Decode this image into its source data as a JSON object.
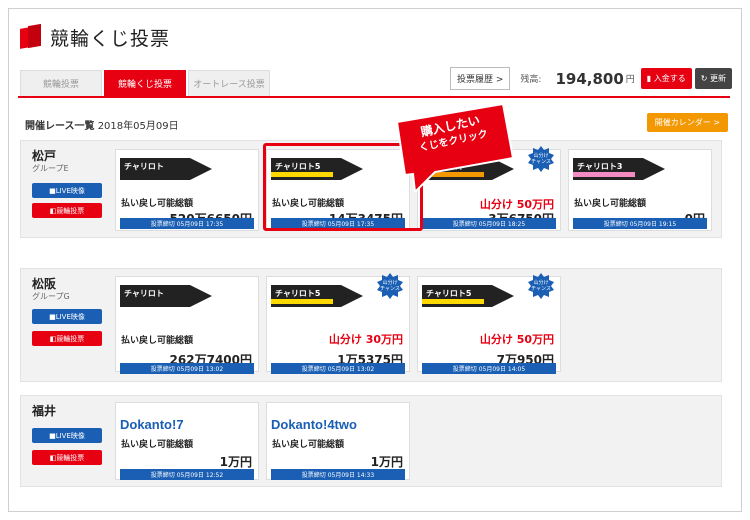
{
  "header": {
    "title": "競輪くじ投票"
  },
  "tabs": [
    {
      "label": "競輪投票",
      "active": false
    },
    {
      "label": "競輪くじ投票",
      "active": true
    },
    {
      "label": "オートレース投票",
      "active": false
    }
  ],
  "account": {
    "history_label": "投票履歴 >",
    "balance_label": "残高:",
    "balance_value": "194,800",
    "balance_unit": "円",
    "deposit_label": "入金する",
    "refresh_label": "更新"
  },
  "list": {
    "title": "開催レース一覧",
    "date": "2018年05月09日",
    "calendar_label": "開催カレンダー >"
  },
  "buttons": {
    "live": "LIVE映像",
    "bet": "競輪投票"
  },
  "payout_label": "払い戻し可能総額",
  "chance_badge": [
    "山分け",
    "チャンス"
  ],
  "callout": {
    "line1": "購入したい",
    "line2": "くじをクリック"
  },
  "races": [
    {
      "venue": "松戸",
      "group": "グループE",
      "cards": [
        {
          "logo": "チャリロト",
          "yamawake": "",
          "amount": "520万6650円",
          "deadline": "投票締切 05月09日 17:35"
        },
        {
          "logo": "チャリロト5",
          "yamawake": "",
          "amount": "14万3475円",
          "deadline": "投票締切 05月09日 17:35"
        },
        {
          "logo": "チャリロト",
          "yamawake": "山分け 50万円",
          "amount": "3万6750円",
          "deadline": "投票締切 05月09日 18:25"
        },
        {
          "logo": "チャリロト3",
          "yamawake": "",
          "amount": "0円",
          "deadline": "投票締切 05月09日 19:15"
        }
      ]
    },
    {
      "venue": "松阪",
      "group": "グループG",
      "cards": [
        {
          "logo": "チャリロト",
          "yamawake": "",
          "amount": "262万7400円",
          "deadline": "投票締切 05月09日 13:02"
        },
        {
          "logo": "チャリロト5",
          "yamawake": "山分け 30万円",
          "amount": "1万5375円",
          "deadline": "投票締切 05月09日 13:02"
        },
        {
          "logo": "チャリロト5",
          "yamawake": "山分け 50万円",
          "amount": "7万950円",
          "deadline": "投票締切 05月09日 14:05"
        }
      ]
    },
    {
      "venue": "福井",
      "group": "",
      "cards": [
        {
          "logo": "Dokanto!7",
          "yamawake": "",
          "amount": "1万円",
          "deadline": "投票締切 05月09日 12:52"
        },
        {
          "logo": "Dokanto!4two",
          "yamawake": "",
          "amount": "1万円",
          "deadline": "投票締切 05月09日 14:33"
        }
      ]
    }
  ],
  "colors": {
    "accent": "#e60012",
    "blue": "#1a5fb4",
    "orange": "#f39800"
  },
  "icons": [
    "ticket-logo-icon",
    "video-icon",
    "bet-icon",
    "refresh-icon",
    "wallet-icon"
  ]
}
